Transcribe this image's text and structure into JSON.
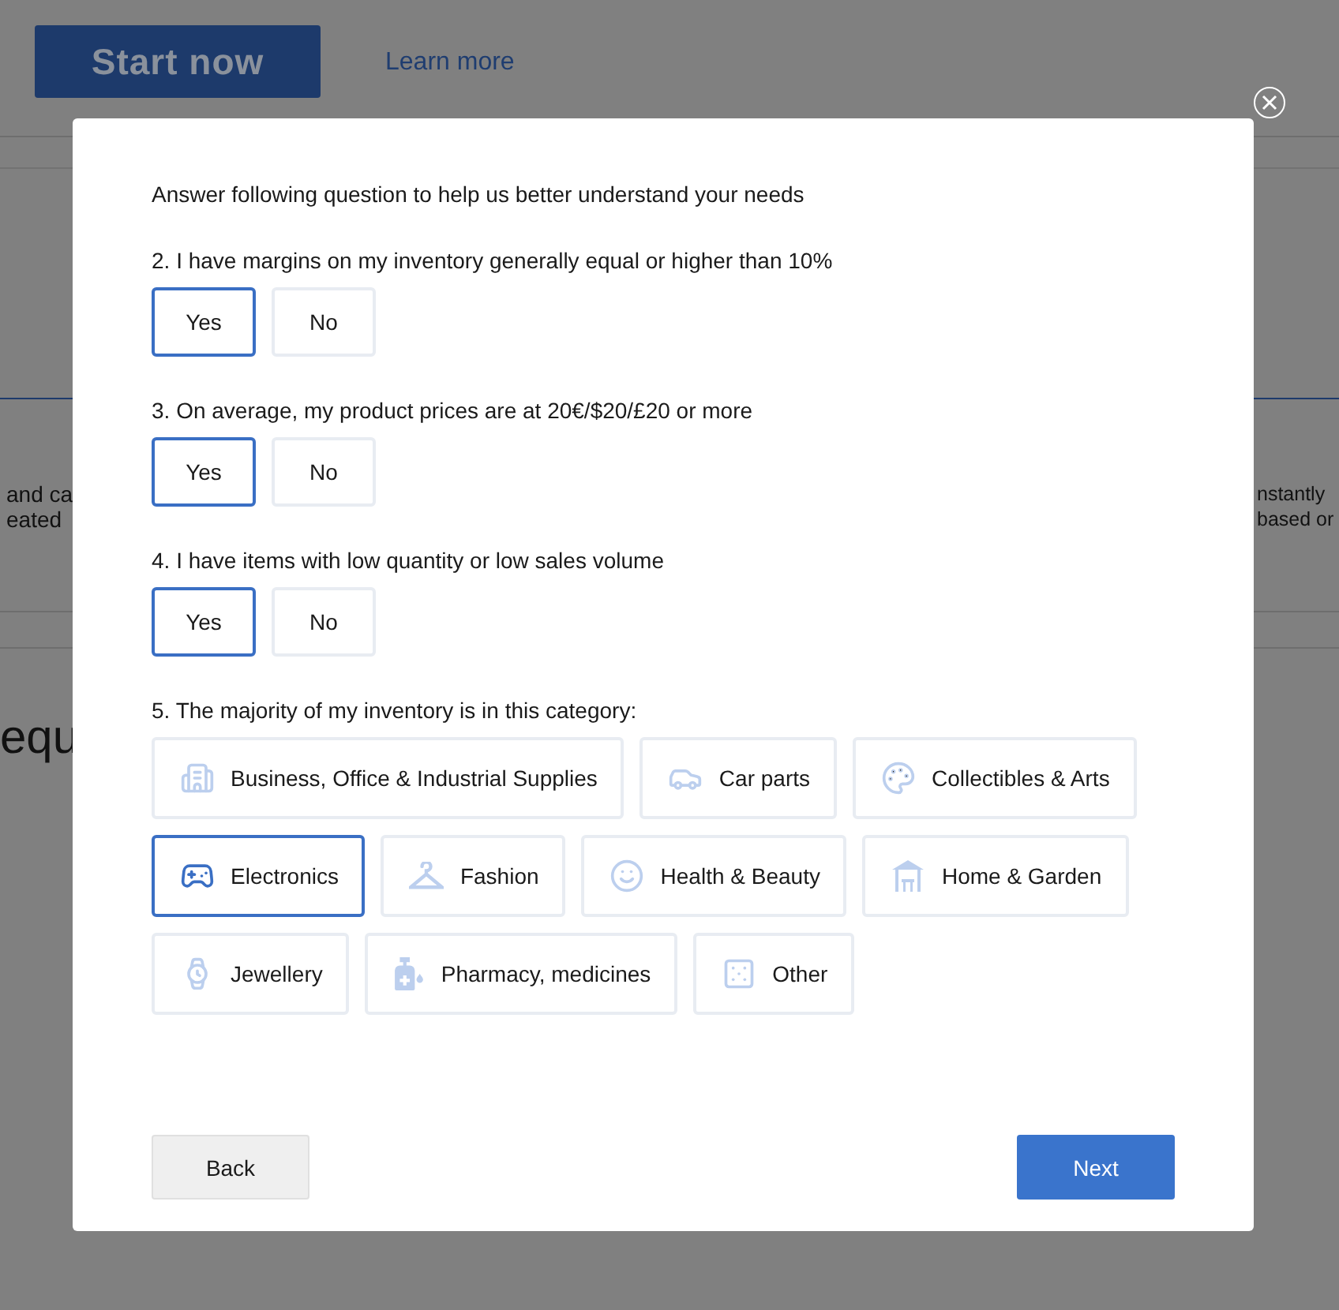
{
  "background": {
    "start_button": "Start now",
    "learn_link": "Learn more",
    "left_fragments": [
      "and ca",
      "eated"
    ],
    "right_fragments": [
      "nstantly",
      "based or"
    ],
    "heading_fragment": "equ"
  },
  "modal": {
    "intro": "Answer following question to help us better understand your needs",
    "questions": [
      {
        "text": "2. I have margins on my inventory generally equal or higher than 10%",
        "options": [
          {
            "label": "Yes",
            "selected": true
          },
          {
            "label": "No",
            "selected": false
          }
        ]
      },
      {
        "text": "3. On average, my product prices are at 20€/$20/£20 or more",
        "options": [
          {
            "label": "Yes",
            "selected": true
          },
          {
            "label": "No",
            "selected": false
          }
        ]
      },
      {
        "text": "4. I have items with low quantity or low sales volume",
        "options": [
          {
            "label": "Yes",
            "selected": true
          },
          {
            "label": "No",
            "selected": false
          }
        ]
      }
    ],
    "category_question": "5. The majority of my inventory is in this category:",
    "categories": [
      {
        "label": "Business, Office & Industrial Supplies",
        "kind": "building",
        "selected": false
      },
      {
        "label": "Car parts",
        "kind": "car",
        "selected": false
      },
      {
        "label": "Collectibles & Arts",
        "kind": "palette",
        "selected": false
      },
      {
        "label": "Electronics",
        "kind": "gamepad",
        "selected": true
      },
      {
        "label": "Fashion",
        "kind": "hanger",
        "selected": false
      },
      {
        "label": "Health & Beauty",
        "kind": "face",
        "selected": false
      },
      {
        "label": "Home & Garden",
        "kind": "gazebo",
        "selected": false
      },
      {
        "label": "Jewellery",
        "kind": "watch",
        "selected": false
      },
      {
        "label": "Pharmacy, medicines",
        "kind": "bottle",
        "selected": false
      },
      {
        "label": "Other",
        "kind": "dice",
        "selected": false
      }
    ],
    "back_button": "Back",
    "next_button": "Next"
  }
}
